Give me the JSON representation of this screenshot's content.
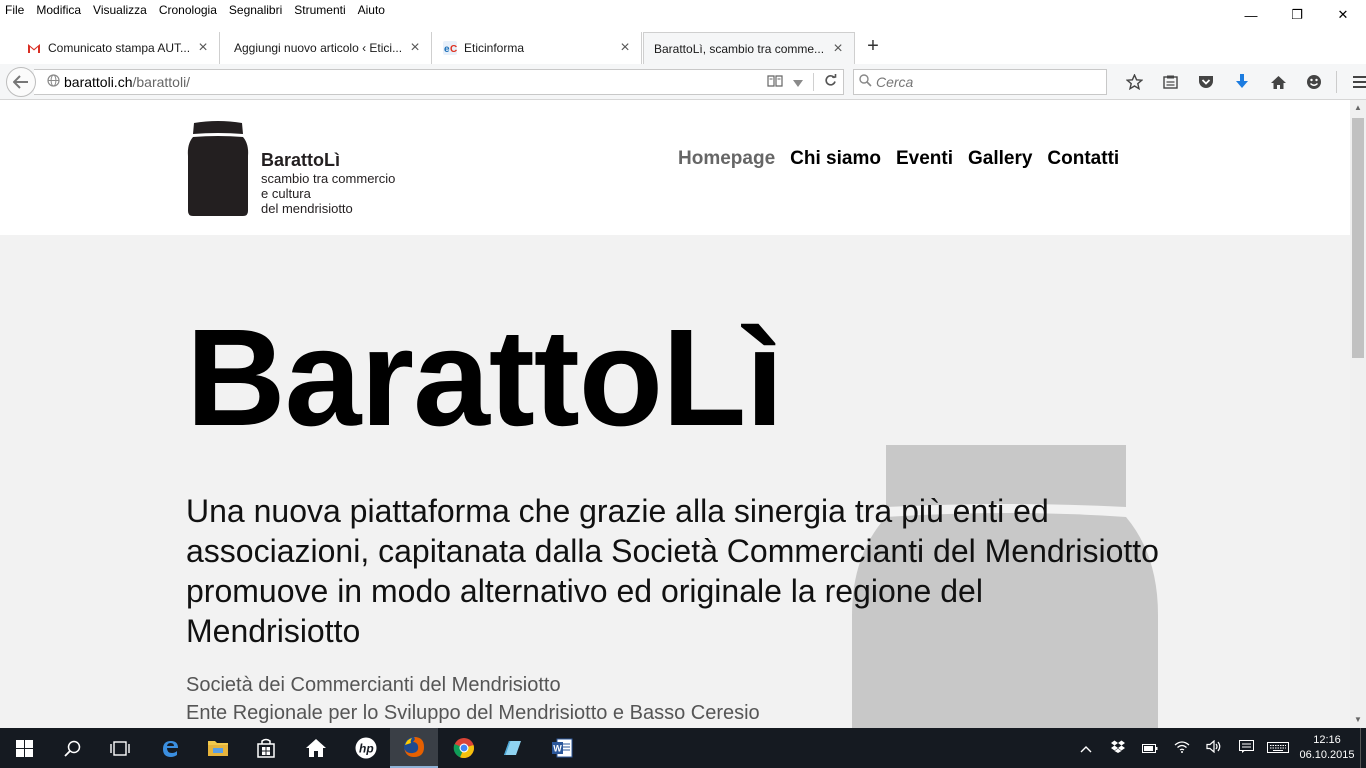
{
  "menubar": {
    "items": [
      "File",
      "Modifica",
      "Visualizza",
      "Cronologia",
      "Segnalibri",
      "Strumenti",
      "Aiuto"
    ]
  },
  "window_controls": {
    "minimize": "—",
    "restore": "❐",
    "close": "✕"
  },
  "tabs": [
    {
      "title": "Comunicato stampa AUT...",
      "favicon": "gmail-icon",
      "active": false
    },
    {
      "title": "Aggiungi nuovo articolo ‹ Etici...",
      "favicon": "wordpress-icon",
      "active": false
    },
    {
      "title": "Eticinforma",
      "favicon": "eticinforma-icon",
      "active": false
    },
    {
      "title": "BarattoLì, scambio tra comme...",
      "favicon": "none",
      "active": true
    }
  ],
  "new_tab_label": "+",
  "navbar": {
    "url_host": "barattoli.ch",
    "url_path": "/barattoli/",
    "search_placeholder": "Cerca"
  },
  "site": {
    "logo": {
      "name": "BarattoLì",
      "tagline_lines": [
        "scambio tra commercio",
        "e cultura",
        "del mendrisiotto"
      ]
    },
    "nav": [
      {
        "label": "Homepage",
        "current": true
      },
      {
        "label": "Chi siamo",
        "current": false
      },
      {
        "label": "Eventi",
        "current": false
      },
      {
        "label": "Gallery",
        "current": false
      },
      {
        "label": "Contatti",
        "current": false
      }
    ],
    "hero": {
      "title": "BarattoLì",
      "lead": "Una nuova piattaforma che grazie alla sinergia tra più enti ed associazioni, capitanata dalla Società Commercianti del Mendrisiotto promuove in modo alternativo ed originale la regione del Mendrisiotto",
      "partners": [
        "Società dei Commercianti del Mendrisiotto",
        "Ente Regionale per lo Sviluppo del Mendrisiotto e Basso Ceresio"
      ]
    }
  },
  "taskbar": {
    "clock_time": "12:16",
    "clock_date": "06.10.2015"
  },
  "colors": {
    "jar_dark": "#231f20",
    "jar_hero": "#c8c8c8",
    "hero_bg": "#f2f2f2",
    "taskbar_bg": "#151a21",
    "download_blue": "#1c7ce0"
  }
}
